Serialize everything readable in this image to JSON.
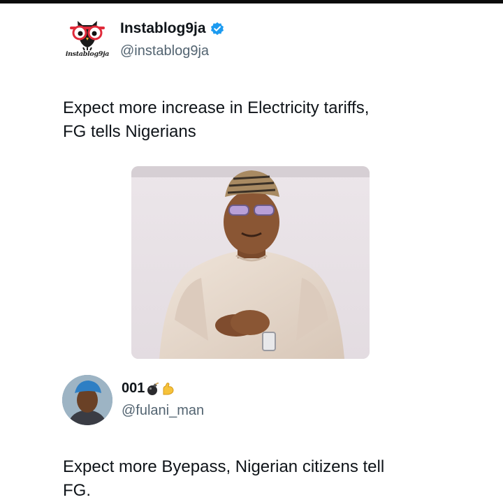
{
  "post": {
    "author_name": "Instablog9ja",
    "handle": "@instablog9ja",
    "logo_text": "instablog9ja",
    "text_lines": [
      "Expect more increase in Electricity tariffs,",
      "FG tells Nigerians"
    ],
    "verified_color": "#1d9bf0",
    "image_icon": "photo"
  },
  "reply": {
    "author_name": "001",
    "name_emojis": [
      "bomb-icon",
      "flexed-biceps-icon"
    ],
    "handle": "@fulani_man",
    "text_lines": [
      "Expect more Byepass, Nigerian citizens tell",
      "FG."
    ]
  },
  "colors": {
    "text": "#0f1419",
    "secondary_text": "#536471",
    "background": "#ffffff"
  }
}
